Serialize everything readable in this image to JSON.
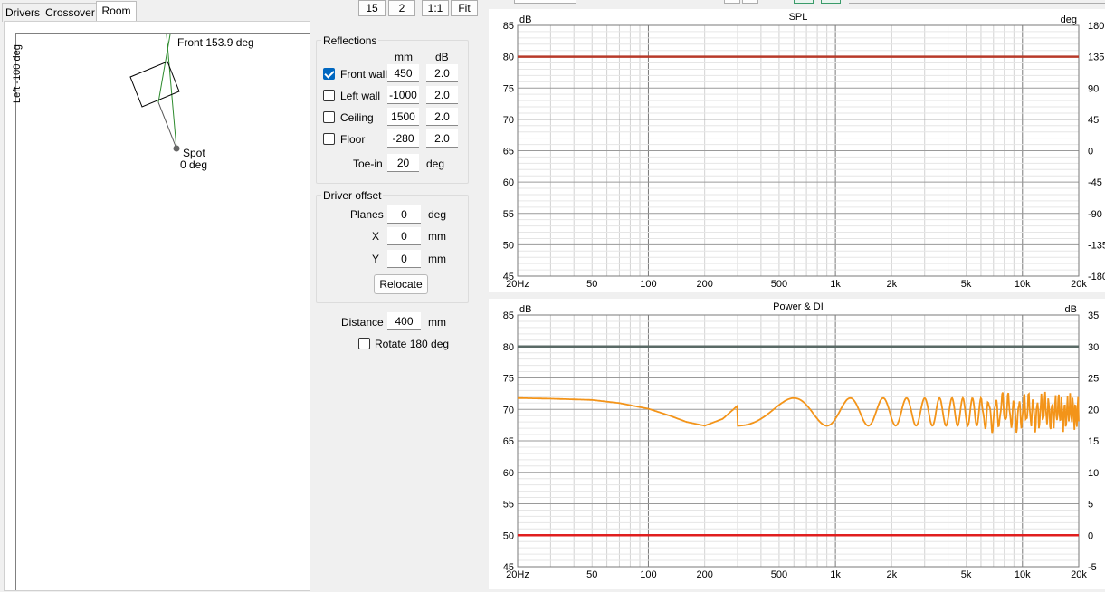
{
  "tabs": [
    "Drivers",
    "Crossover",
    "Room"
  ],
  "toolbar": [
    "15",
    "2",
    "1:1",
    "Fit"
  ],
  "room_view": {
    "front_label": "Front 153.9 deg",
    "left_label": "Left -100 deg",
    "spot_label": "Spot",
    "spot_angle": "0 deg"
  },
  "reflections": {
    "title": "Reflections",
    "col_mm": "mm",
    "col_db": "dB",
    "rows": [
      {
        "label": "Front wall",
        "checked": true,
        "mm": "450",
        "db": "2.0"
      },
      {
        "label": "Left wall",
        "checked": false,
        "mm": "-1000",
        "db": "2.0"
      },
      {
        "label": "Ceiling",
        "checked": false,
        "mm": "1500",
        "db": "2.0"
      },
      {
        "label": "Floor",
        "checked": false,
        "mm": "-280",
        "db": "2.0"
      }
    ],
    "toe_in_label": "Toe-in",
    "toe_in_value": "20",
    "toe_in_unit": "deg"
  },
  "driver_offset": {
    "title": "Driver offset",
    "planes_label": "Planes",
    "planes_value": "0",
    "planes_unit": "deg",
    "x_label": "X",
    "x_value": "0",
    "x_unit": "mm",
    "y_label": "Y",
    "y_value": "0",
    "y_unit": "mm",
    "relocate_label": "Relocate"
  },
  "distance": {
    "label": "Distance",
    "value": "400",
    "unit": "mm"
  },
  "rotate": {
    "label": "Rotate 180 deg",
    "checked": false
  },
  "colors": {
    "grid": "#d2d2d2",
    "grid_major": "#7a7a7a",
    "spl_line": "#b83a2a",
    "power_line": "#5a6a66",
    "di_line": "#e01e1e",
    "response": "#f39419"
  },
  "chart_data": [
    {
      "type": "line",
      "title": "SPL",
      "ylabel_left": "dB",
      "ylabel_right": "deg",
      "x_scale": "log",
      "xlim": [
        20,
        20000
      ],
      "x_ticks": [
        "20Hz",
        "50",
        "100",
        "200",
        "500",
        "1k",
        "2k",
        "5k",
        "10k",
        "20k"
      ],
      "ylim": [
        45,
        85
      ],
      "y_ticks": [
        "85",
        "80",
        "75",
        "70",
        "65",
        "60",
        "55",
        "50",
        "45"
      ],
      "y2lim": [
        -180,
        180
      ],
      "y2_ticks": [
        "180",
        "135",
        "90",
        "45",
        "0",
        "-45",
        "-90",
        "-135",
        "-180"
      ],
      "grid": true,
      "series": [
        {
          "x": [
            20,
            20000
          ],
          "y": [
            80,
            80
          ],
          "color": "#b83a2a"
        }
      ]
    },
    {
      "type": "line",
      "title": "Power & DI",
      "ylabel_left": "dB",
      "ylabel_right": "dB",
      "x_scale": "log",
      "xlim": [
        20,
        20000
      ],
      "x_ticks": [
        "20Hz",
        "50",
        "100",
        "200",
        "500",
        "1k",
        "2k",
        "5k",
        "10k",
        "20k"
      ],
      "ylim": [
        45,
        85
      ],
      "y_ticks": [
        "85",
        "80",
        "75",
        "70",
        "65",
        "60",
        "55",
        "50",
        "45"
      ],
      "y2lim": [
        -5,
        35
      ],
      "y2_ticks": [
        "35",
        "30",
        "25",
        "20",
        "15",
        "10",
        "5",
        "0",
        "-5"
      ],
      "grid": true,
      "series": [
        {
          "x": [
            20,
            20000
          ],
          "y": [
            80,
            80
          ],
          "color": "#5a6a66"
        },
        {
          "x": [
            20,
            20000
          ],
          "y": [
            50,
            50
          ],
          "color": "#e01e1e"
        },
        {
          "x": [
            20,
            30,
            50,
            70,
            100,
            130,
            160,
            200,
            250,
            300,
            400,
            500,
            600,
            700,
            800,
            900,
            1000,
            1200,
            1500,
            2000,
            3000,
            5000,
            8000,
            10000,
            15000,
            20000
          ],
          "y": [
            71.8,
            71.7,
            71.5,
            71.0,
            70.1,
            69.0,
            68.0,
            67.4,
            68.5,
            70.6,
            71.8,
            70.2,
            67.3,
            70.8,
            71.6,
            69.0,
            67.3,
            71.7,
            67.5,
            71.5,
            67.6,
            71.6,
            67.8,
            72.2,
            66.8,
            70.5
          ],
          "color": "#f39419",
          "note_shape": "decaying comb ripple above 300 Hz, tighter spacing toward high frequency"
        }
      ]
    }
  ]
}
